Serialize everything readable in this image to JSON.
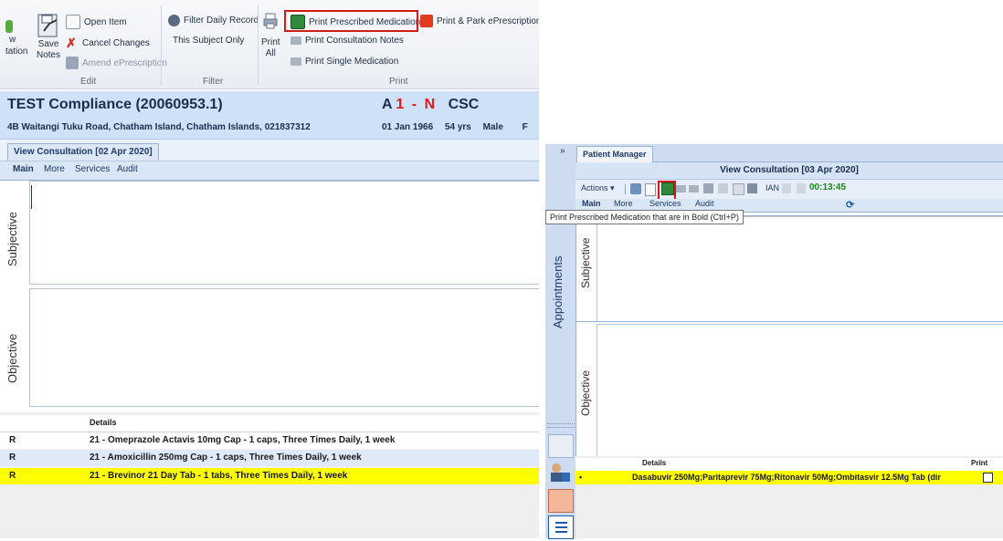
{
  "ribbon": {
    "left_partial": "w",
    "left_partial2": "tation",
    "save_notes_1": "Save",
    "save_notes_2": "Notes",
    "open_item": "Open Item",
    "cancel_changes": "Cancel Changes",
    "amend_eprescription": "Amend ePrescription",
    "group_edit": "Edit",
    "filter_daily_record": "Filter Daily Record",
    "this_subject_only": "This Subject Only",
    "group_filter": "Filter",
    "print_all_1": "Print",
    "print_all_2": "All",
    "print_prescribed_meds": "Print Prescribed Medications",
    "print_park_eprescription": "Print & Park ePrescription",
    "print_consultation_notes": "Print Consultation Notes",
    "print_single_medication": "Print Single Medication",
    "group_print": "Print"
  },
  "patient": {
    "name": "TEST Compliance (20060953.1)",
    "address": "4B Waitangi Tuku Road, Chatham Island, Chatham Islands, 021837312",
    "flag_a": "A",
    "flag_1": "1",
    "flag_dash": "-",
    "flag_n": "N",
    "flag_csc": "CSC",
    "dob": "01 Jan 1966",
    "age": "54 yrs",
    "sex": "Male",
    "trailing": "F"
  },
  "left_consult": {
    "tab_label": "View Consultation [02 Apr 2020]",
    "subtabs": [
      "Main",
      "More",
      "Services",
      "Audit"
    ],
    "subjective": "Subjective",
    "objective": "Objective"
  },
  "left_meds": {
    "header_details": "Details",
    "rows": [
      {
        "type": "R",
        "details": "21 - Omeprazole Actavis 10mg Cap - 1 caps, Three Times Daily, 1 week",
        "bg": "#ffffff"
      },
      {
        "type": "R",
        "details": "21 - Amoxicillin 250mg Cap - 1 caps, Three Times Daily, 1 week",
        "bg": "#dfe9f7"
      },
      {
        "type": "R",
        "details": "21 - Brevinor 21 Day Tab - 1 tabs, Three Times Daily, 1 week",
        "bg": "#ffff00"
      }
    ]
  },
  "right_panel": {
    "collapse_glyph": "»",
    "tab_label": "Patient Manager",
    "consult_title": "View Consultation  [03 Apr 2020]",
    "actions_label": "Actions",
    "ian_label": "IAN",
    "timer": "00:13:45",
    "subtabs": [
      "Main",
      "More",
      "Services",
      "Audit"
    ],
    "tooltip": "Print Prescribed Medication that are in Bold (Ctrl+P)",
    "appointments": "Appointments",
    "subjective": "Subjective",
    "objective": "Objective",
    "med_header_details": "Details",
    "med_header_print": "Print",
    "med_row_bullet": "•",
    "med_row_details": "Dasabuvir 250Mg;Paritaprevir 75Mg;Ritonavir 50Mg;Ombitasvir 12.5Mg Tab (dir",
    "med_row_print_checked": false
  },
  "colors": {
    "highlight_yellow": "#ffff00",
    "callout_red": "#d11b1b",
    "header_blue": "#cfe1f7",
    "timer_green": "#1a8a1a"
  }
}
